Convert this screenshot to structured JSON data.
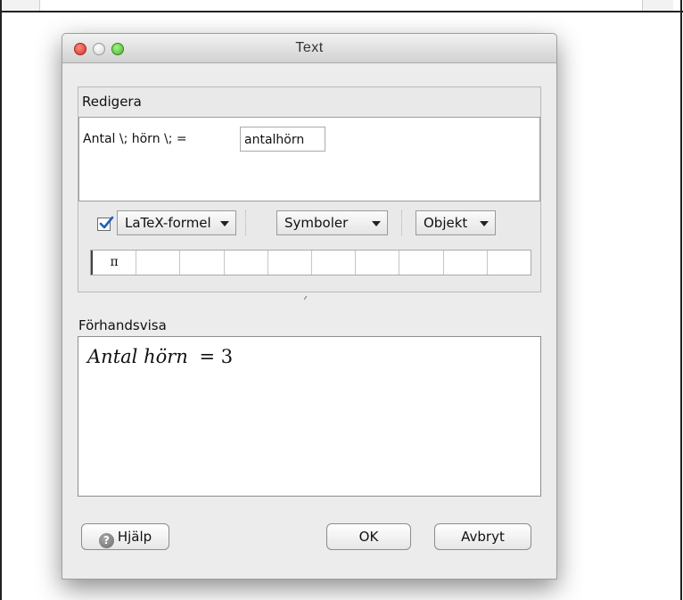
{
  "window": {
    "title": "Text",
    "traffic_lights": {
      "close_color": "#e0443b",
      "minimize_color": "#d6d6d6",
      "maximize_color": "#5cc33f"
    }
  },
  "edit": {
    "section_label": "Redigera",
    "content_text": "Antal  \\; hörn \\; =",
    "embedded_object": "antalhörn",
    "latex_enabled": true,
    "latex_dropdown": "LaTeX-formel",
    "symbols_dropdown": "Symboler",
    "objects_dropdown": "Objekt",
    "symbol_cells": [
      "π",
      "",
      "",
      "",
      "",
      "",
      "",
      "",
      "",
      ""
    ]
  },
  "preview": {
    "section_label": "Förhandsvisa",
    "rendered_word1": "Antal",
    "rendered_word2": "hörn",
    "rendered_rest": "= 3"
  },
  "buttons": {
    "help": "Hjälp",
    "ok": "OK",
    "cancel": "Avbryt"
  },
  "icons": {
    "help": "question-mark-icon",
    "checkbox": "checkmark-icon",
    "dropdown": "chevron-down-icon"
  }
}
